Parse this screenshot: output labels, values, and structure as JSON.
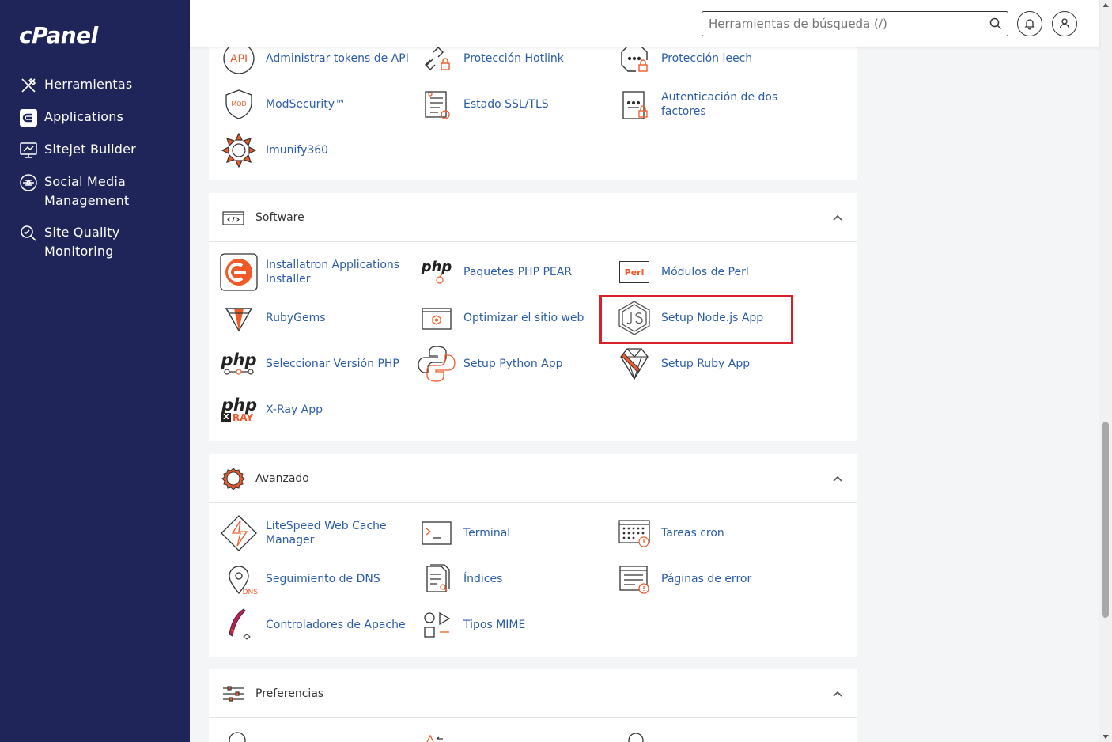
{
  "app": {
    "logo": "cPanel"
  },
  "sidebar": {
    "items": [
      {
        "label": "Herramientas",
        "icon": "tools-icon"
      },
      {
        "label": "Applications",
        "icon": "applications-icon"
      },
      {
        "label": "Sitejet Builder",
        "icon": "sitejet-icon"
      },
      {
        "label": "Social Media Management",
        "icon": "social-media-icon"
      },
      {
        "label": "Site Quality Monitoring",
        "icon": "site-quality-icon"
      }
    ]
  },
  "header": {
    "search_placeholder": "Herramientas de búsqueda (/)",
    "notifications_icon": "bell-icon",
    "user_icon": "user-icon"
  },
  "security": {
    "items": [
      {
        "label": "Administrar tokens de API",
        "icon": "api-icon"
      },
      {
        "label": "Protección Hotlink",
        "icon": "hotlink-icon"
      },
      {
        "label": "Protección leech",
        "icon": "leech-icon"
      },
      {
        "label": "ModSecurity™",
        "icon": "modsecurity-icon"
      },
      {
        "label": "Estado SSL/TLS",
        "icon": "ssl-icon"
      },
      {
        "label": "Autenticación de dos factores",
        "icon": "two-factor-icon"
      },
      {
        "label": "Imunify360",
        "icon": "imunify-icon"
      }
    ]
  },
  "software": {
    "title": "Software",
    "items": [
      {
        "label": "Installatron Applications Installer",
        "icon": "installatron-icon"
      },
      {
        "label": "Paquetes PHP PEAR",
        "icon": "php-pear-icon"
      },
      {
        "label": "Módulos de Perl",
        "icon": "perl-icon"
      },
      {
        "label": "RubyGems",
        "icon": "rubygems-icon"
      },
      {
        "label": "Optimizar el sitio web",
        "icon": "optimize-icon"
      },
      {
        "label": "Setup Node.js App",
        "icon": "nodejs-icon"
      },
      {
        "label": "Seleccionar Versión PHP",
        "icon": "php-version-icon"
      },
      {
        "label": "Setup Python App",
        "icon": "python-icon"
      },
      {
        "label": "Setup Ruby App",
        "icon": "ruby-icon"
      },
      {
        "label": "X-Ray App",
        "icon": "xray-icon"
      }
    ],
    "php_text": "php",
    "perl_text": "Perl",
    "xray_text": "RAY"
  },
  "advanced": {
    "title": "Avanzado",
    "items": [
      {
        "label": "LiteSpeed Web Cache Manager",
        "icon": "litespeed-icon"
      },
      {
        "label": "Terminal",
        "icon": "terminal-icon"
      },
      {
        "label": "Tareas cron",
        "icon": "cron-icon"
      },
      {
        "label": "Seguimiento de DNS",
        "icon": "dns-icon"
      },
      {
        "label": "Índices",
        "icon": "indexes-icon"
      },
      {
        "label": "Páginas de error",
        "icon": "error-pages-icon"
      },
      {
        "label": "Controladores de Apache",
        "icon": "apache-icon"
      },
      {
        "label": "Tipos MIME",
        "icon": "mime-icon"
      }
    ],
    "dns_text": "DNS"
  },
  "preferences": {
    "title": "Preferencias"
  },
  "colors": {
    "sidebar": "#1f2459",
    "accent": "#f05a28",
    "link": "#2a5ca8",
    "highlight": "#d9202a"
  }
}
